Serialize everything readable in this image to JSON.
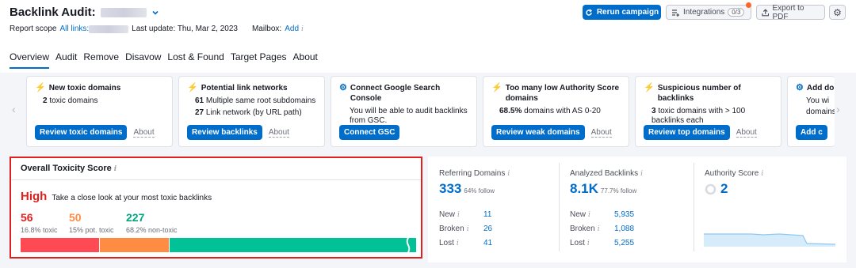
{
  "header": {
    "title": "Backlink Audit:",
    "report_scope_label": "Report scope",
    "all_links": "All links:",
    "last_update": "Last update: Thu, Mar 2, 2023",
    "mailbox_label": "Mailbox:",
    "mailbox_add": "Add",
    "run_campaign": "Rerun campaign",
    "integrations": "Integrations",
    "integrations_badge": "0/3",
    "export": "Export to PDF"
  },
  "tabs": [
    "Overview",
    "Audit",
    "Remove",
    "Disavow",
    "Lost & Found",
    "Target Pages",
    "About"
  ],
  "cards": [
    {
      "title": "New toxic domains",
      "line1_num": "2",
      "line1": "toxic domains",
      "button": "Review toxic domains",
      "about": "About"
    },
    {
      "title": "Potential link networks",
      "line1_num": "61",
      "line1": "Multiple same root subdomains",
      "line2_num": "27",
      "line2": "Link network (by URL path)",
      "button": "Review backlinks",
      "about": "About"
    },
    {
      "title": "Connect Google Search Console",
      "line1": "You will be able to audit backlinks from GSC.",
      "button": "Connect GSC"
    },
    {
      "title": "Too many low Authority Score domains",
      "line1_num": "68.5%",
      "line1": "domains with AS 0-20",
      "button": "Review weak domains",
      "about": "About"
    },
    {
      "title": "Suspicious number of backlinks",
      "line1_num": "3",
      "line1": "toxic domains with > 100 backlinks each",
      "button": "Review top domains",
      "about": "About"
    },
    {
      "title": "Add do",
      "line1": "You wi",
      "line1b": "domains",
      "button": "Add c"
    }
  ],
  "toxicity": {
    "title": "Overall Toxicity Score",
    "level": "High",
    "description": "Take a close look at your most toxic backlinks",
    "toxic": {
      "value": "56",
      "label": "16.8% toxic",
      "pct": 16.8
    },
    "potential": {
      "value": "50",
      "label": "15% pot. toxic",
      "pct": 15
    },
    "non_toxic": {
      "value": "227",
      "label": "68.2% non-toxic",
      "pct": 68.2
    }
  },
  "referring_domains": {
    "title": "Referring Domains",
    "value": "333",
    "sub": "64% follow",
    "rows": [
      {
        "k": "New",
        "v": "11"
      },
      {
        "k": "Broken",
        "v": "26"
      },
      {
        "k": "Lost",
        "v": "41"
      }
    ]
  },
  "analyzed_backlinks": {
    "title": "Analyzed Backlinks",
    "value": "8.1K",
    "sub": "77.7% follow",
    "rows": [
      {
        "k": "New",
        "v": "5,935"
      },
      {
        "k": "Broken",
        "v": "1,088"
      },
      {
        "k": "Lost",
        "v": "5,255"
      }
    ]
  },
  "authority_score": {
    "title": "Authority Score",
    "value": "2"
  },
  "colors": {
    "accent": "#006dca",
    "toxic": "#ff4953",
    "potential": "#ff8c43",
    "non_toxic": "#00c296",
    "high": "#e0201e"
  }
}
